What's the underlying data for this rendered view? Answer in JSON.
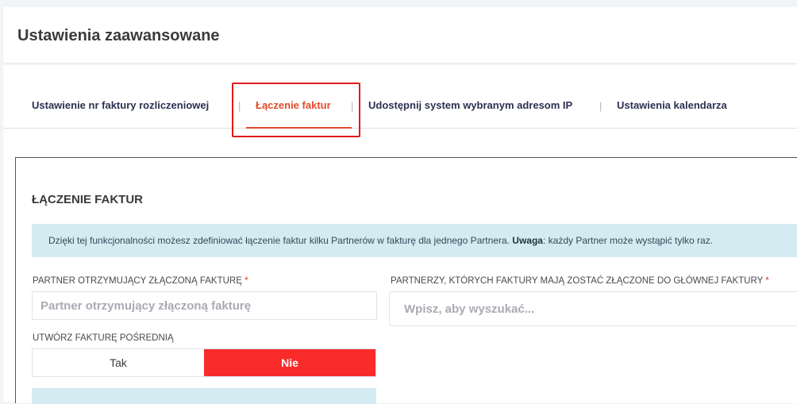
{
  "header": {
    "title": "Ustawienia zaawansowane"
  },
  "tabs": [
    {
      "label": "Ustawienie nr faktury rozliczeniowej",
      "active": false
    },
    {
      "label": "Łączenie faktur",
      "active": true
    },
    {
      "label": "Udostępnij system wybranym adresom IP",
      "active": false
    },
    {
      "label": "Ustawienia kalendarza",
      "active": false
    }
  ],
  "tab_separator": "|",
  "section": {
    "title": "ŁĄCZENIE FAKTUR",
    "info_text_1": "Dzięki tej funkcjonalności możesz zdefiniować łączenie faktur kilku Partnerów w fakturę dla jednego Partnera. ",
    "info_bold": "Uwaga",
    "info_text_2": ": każdy Partner może wystąpić tylko raz."
  },
  "form": {
    "receiving_partner": {
      "label": "PARTNER OTRZYMUJĄCY ZŁĄCZONĄ FAKTURĘ",
      "required_mark": "*",
      "placeholder": "Partner otrzymujący złączoną fakturę"
    },
    "merged_partners": {
      "label": "PARTNERZY, KTÓRYCH FAKTURY MAJĄ ZOSTAĆ ZŁĄCZONE DO GŁÓWNEJ FAKTURY",
      "required_mark": "*",
      "placeholder": "Wpisz, aby wyszukać..."
    },
    "intermediate_invoice": {
      "label": "UTWÓRZ FAKTURĘ POŚREDNIĄ",
      "option_yes": "Tak",
      "option_no": "Nie",
      "selected": "Nie"
    }
  },
  "colors": {
    "accent": "#e24a2a",
    "toggle_active": "#fa2b2b",
    "info_bg": "#d4ecf1",
    "highlight": "#e11b1b"
  }
}
